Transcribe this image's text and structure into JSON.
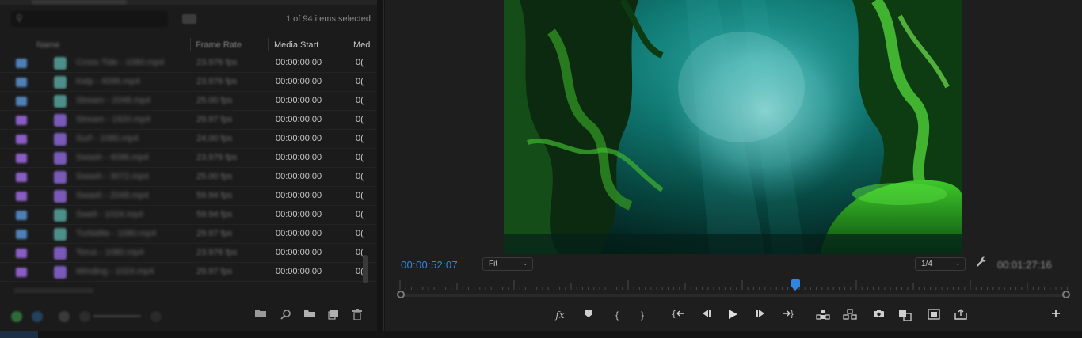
{
  "project_panel": {
    "selection_count": "1 of 94 items selected",
    "columns": {
      "name": "Name",
      "frame_rate": "Frame Rate",
      "media_start": "Media Start",
      "media_end": "Med"
    },
    "rows": [
      {
        "label_color": "#4e7fb5",
        "type_color": "#4d8f88",
        "name": "Cross Tide - 1080.mp4",
        "frame_rate": "23.976 fps",
        "media_start": "00:00:00:00",
        "media_end": "0("
      },
      {
        "label_color": "#4e7fb5",
        "type_color": "#4d8f88",
        "name": "Kelp - 4096.mp4",
        "frame_rate": "23.976 fps",
        "media_start": "00:00:00:00",
        "media_end": "0("
      },
      {
        "label_color": "#4e7fb5",
        "type_color": "#4d8f88",
        "name": "Stream - 2048.mp4",
        "frame_rate": "25.00 fps",
        "media_start": "00:00:00:00",
        "media_end": "0("
      },
      {
        "label_color": "#8a5dc4",
        "type_color": "#7a5ab8",
        "name": "Stream - 1920.mp4",
        "frame_rate": "29.97 fps",
        "media_start": "00:00:00:00",
        "media_end": "0("
      },
      {
        "label_color": "#8a5dc4",
        "type_color": "#7a5ab8",
        "name": "Surf - 1080.mp4",
        "frame_rate": "24.00 fps",
        "media_start": "00:00:00:00",
        "media_end": "0("
      },
      {
        "label_color": "#8a5dc4",
        "type_color": "#7a5ab8",
        "name": "Swash - 4096.mp4",
        "frame_rate": "23.976 fps",
        "media_start": "00:00:00:00",
        "media_end": "0("
      },
      {
        "label_color": "#8a5dc4",
        "type_color": "#7a5ab8",
        "name": "Swash - 3072.mp4",
        "frame_rate": "25.00 fps",
        "media_start": "00:00:00:00",
        "media_end": "0("
      },
      {
        "label_color": "#8a5dc4",
        "type_color": "#7a5ab8",
        "name": "Swash - 2048.mp4",
        "frame_rate": "59.94 fps",
        "media_start": "00:00:00:00",
        "media_end": "0("
      },
      {
        "label_color": "#4e7fb5",
        "type_color": "#4d8f88",
        "name": "Swell - 1024.mp4",
        "frame_rate": "59.94 fps",
        "media_start": "00:00:00:00",
        "media_end": "0("
      },
      {
        "label_color": "#4e7fb5",
        "type_color": "#4d8f88",
        "name": "Turbidite - 1080.mp4",
        "frame_rate": "29.97 fps",
        "media_start": "00:00:00:00",
        "media_end": "0("
      },
      {
        "label_color": "#8a5dc4",
        "type_color": "#7a5ab8",
        "name": "Torus - 1080.mp4",
        "frame_rate": "23.976 fps",
        "media_start": "00:00:00:00",
        "media_end": "0("
      },
      {
        "label_color": "#8a5dc4",
        "type_color": "#7a5ab8",
        "name": "Winding - 1024.mp4",
        "frame_rate": "29.97 fps",
        "media_start": "00:00:00:00",
        "media_end": "0("
      }
    ],
    "footer_icons": [
      "new-bin-icon",
      "find-icon",
      "folder-icon",
      "new-item-icon",
      "trash-icon"
    ]
  },
  "program_monitor": {
    "timecode_current": "00:00:52:07",
    "zoom_select": "Fit",
    "resolution_select": "1/4",
    "timecode_duration": "00:01:27:16",
    "playhead_fraction": 0.596,
    "accent_color": "#2f86e0",
    "controls": [
      {
        "name": "fx-button",
        "glyph": "fx"
      },
      {
        "name": "add-marker-button",
        "glyph": "marker"
      },
      {
        "name": "mark-in-button",
        "glyph": "{"
      },
      {
        "name": "mark-out-button",
        "glyph": "}"
      },
      {
        "name": "go-to-in-button",
        "glyph": "{←"
      },
      {
        "name": "step-back-button",
        "glyph": "◀|"
      },
      {
        "name": "play-button",
        "glyph": "▶"
      },
      {
        "name": "step-forward-button",
        "glyph": "|▶"
      },
      {
        "name": "go-to-out-button",
        "glyph": "→}"
      },
      {
        "name": "lift-button",
        "glyph": "lift"
      },
      {
        "name": "extract-button",
        "glyph": "extract"
      },
      {
        "name": "export-frame-button",
        "glyph": "camera"
      },
      {
        "name": "comparison-view-button",
        "glyph": "compare"
      },
      {
        "name": "toggle-proxies-button",
        "glyph": "proxies"
      },
      {
        "name": "export-button",
        "glyph": "export"
      },
      {
        "name": "button-editor-button",
        "glyph": "+"
      }
    ]
  }
}
